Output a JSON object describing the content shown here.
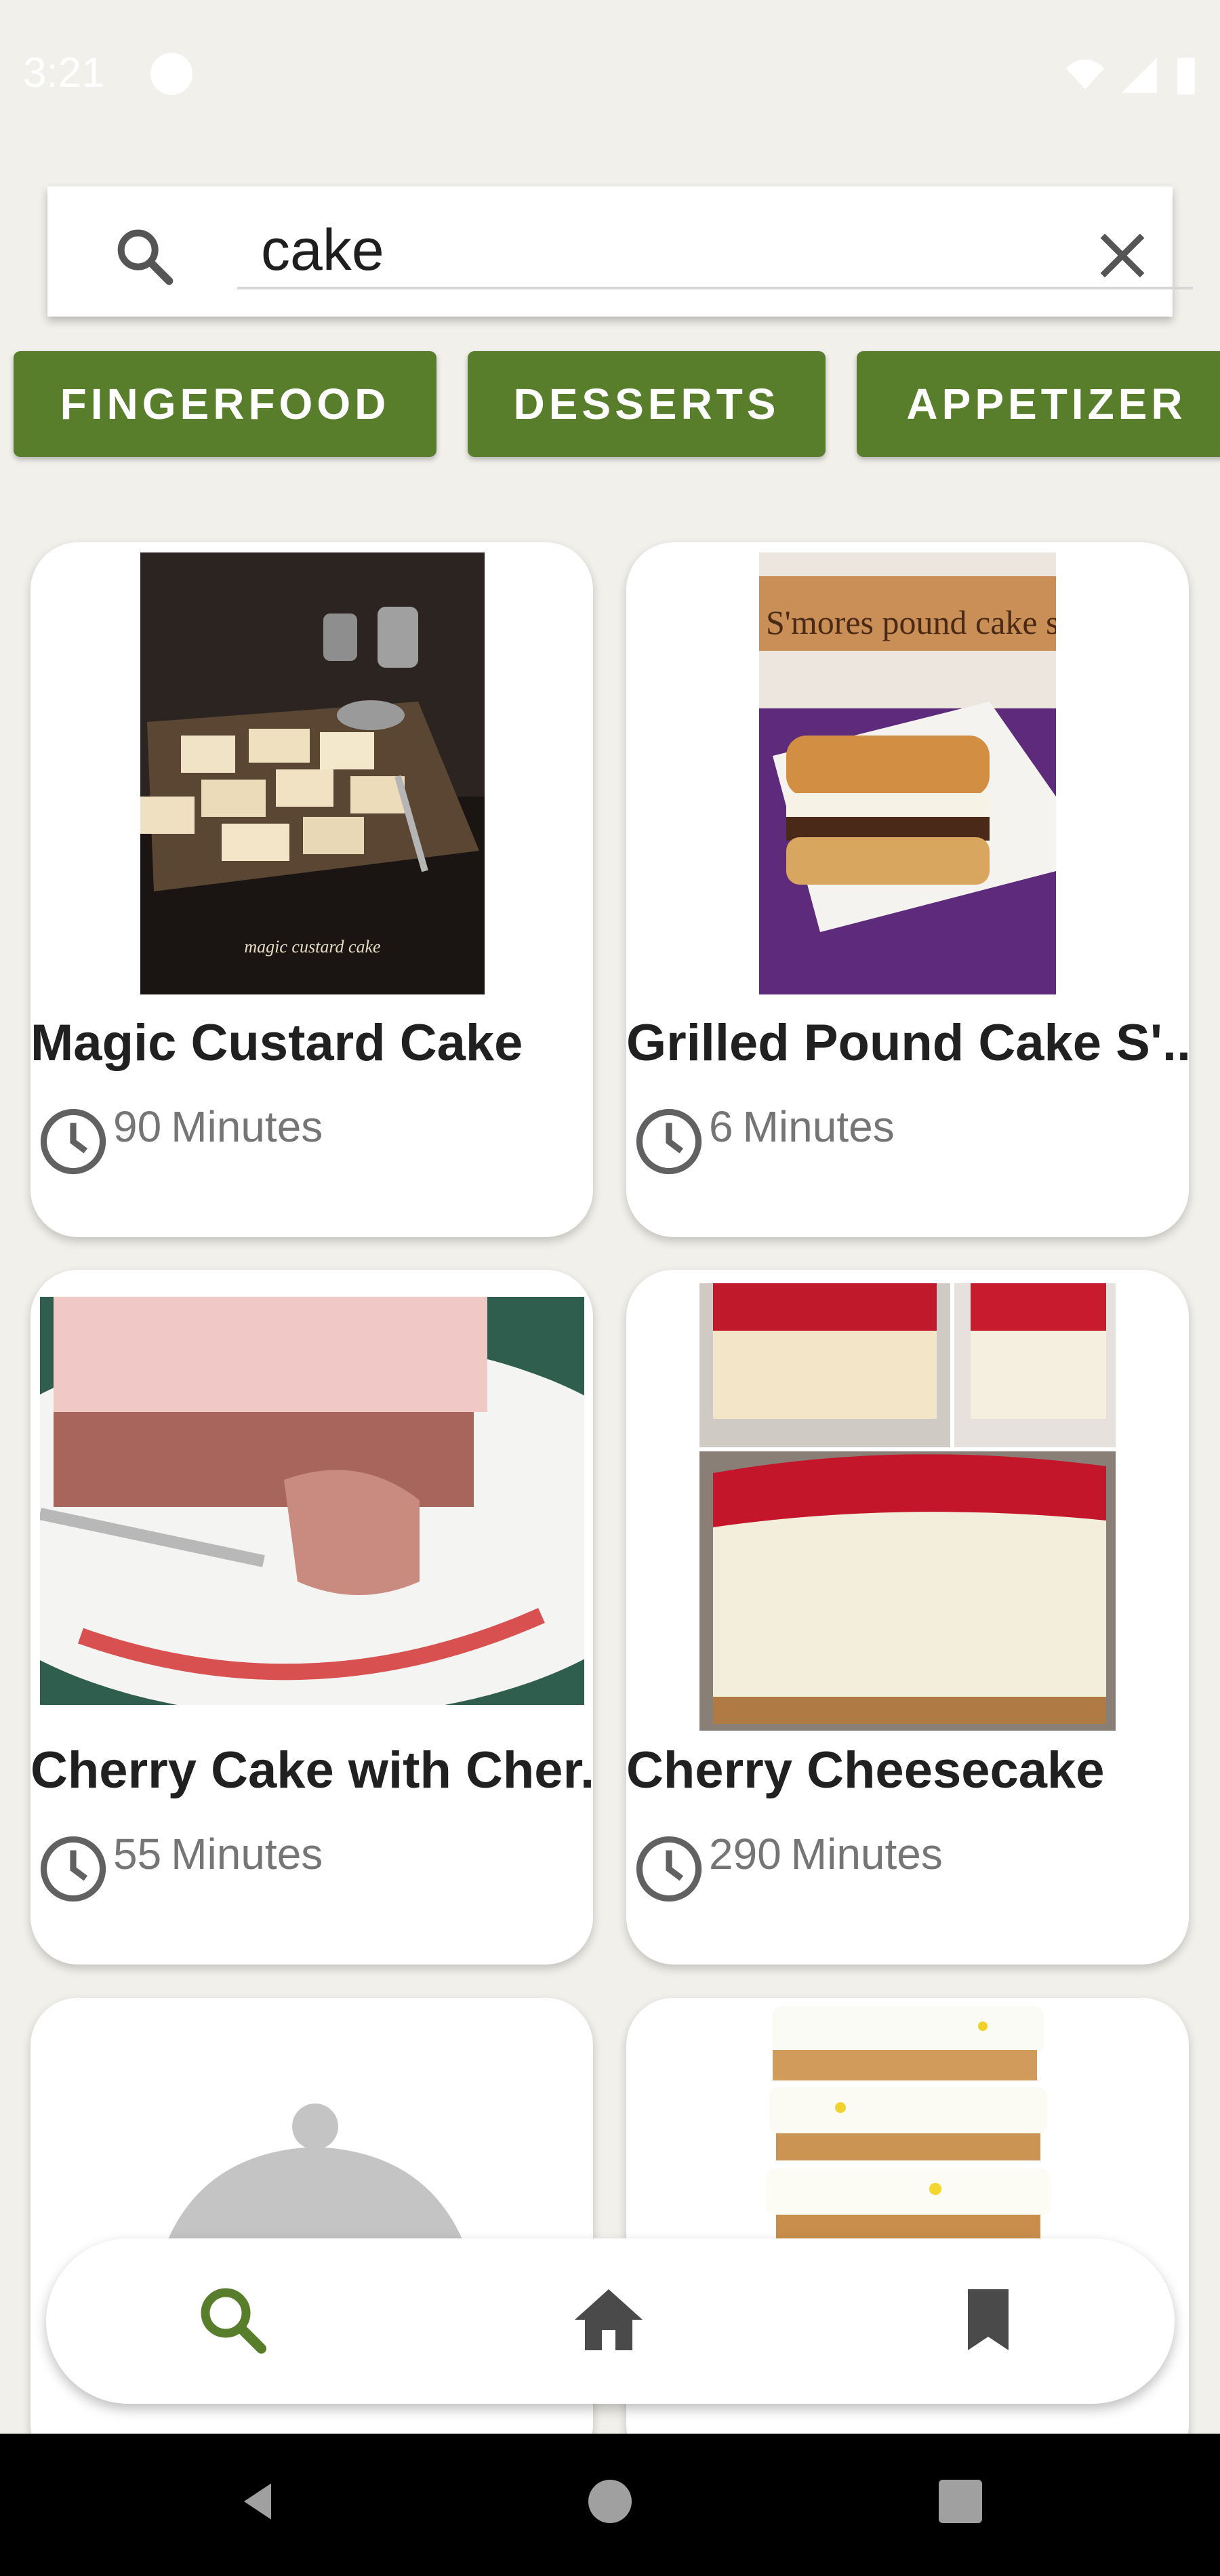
{
  "status_bar": {
    "time": "3:21"
  },
  "search": {
    "value": "cake"
  },
  "categories": [
    "FINGERFOOD",
    "DESSERTS",
    "APPETIZER"
  ],
  "recipes": [
    {
      "title": "Magic Custard Cake",
      "minutes": "90",
      "unit": "Minutes",
      "image_caption": "magic custard cake"
    },
    {
      "title": "Grilled Pound Cake S'..",
      "minutes": "6",
      "unit": "Minutes",
      "image_caption": "S'mores pound cake sandwiches"
    },
    {
      "title": "Cherry Cake with Cher..",
      "minutes": "55",
      "unit": "Minutes"
    },
    {
      "title": "Cherry Cheesecake",
      "minutes": "290",
      "unit": "Minutes"
    }
  ],
  "bottom_nav": {
    "active": "search",
    "items": [
      "search-icon",
      "home-icon",
      "bookmark-icon"
    ],
    "active_color": "#587d2b"
  }
}
